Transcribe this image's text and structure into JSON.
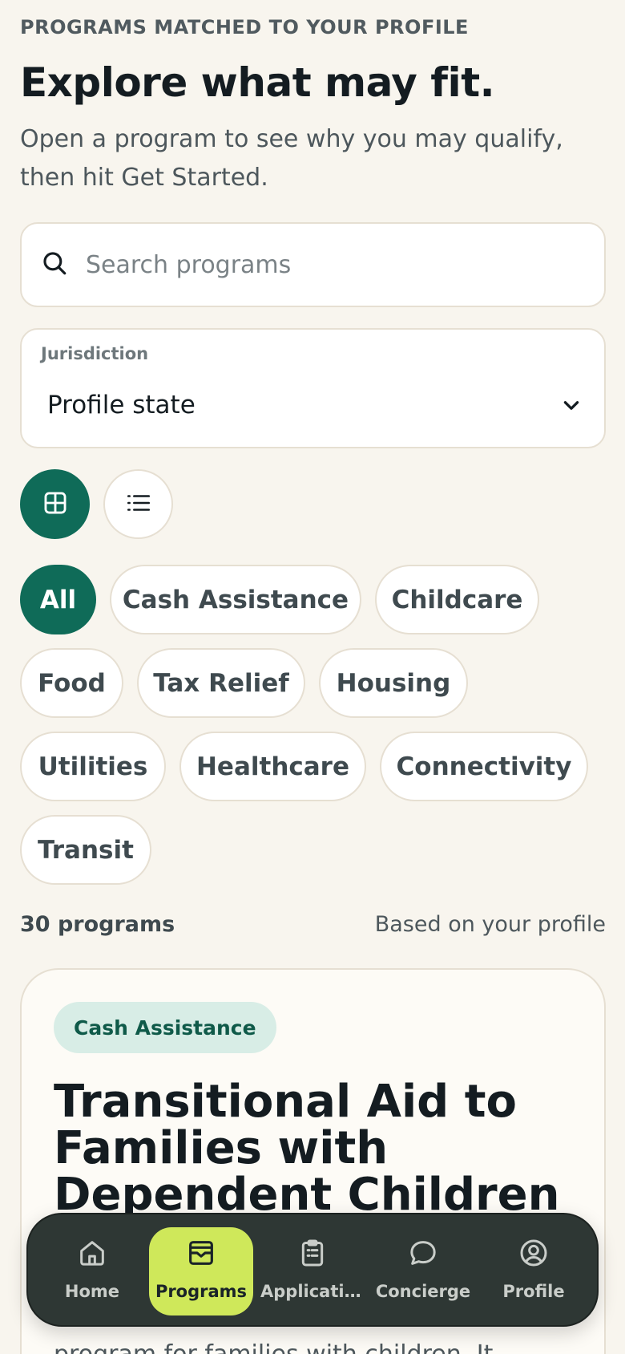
{
  "header": {
    "eyebrow": "PROGRAMS MATCHED TO YOUR PROFILE",
    "title": "Explore what may fit.",
    "subtitle": "Open a program to see why you may qualify, then hit Get Started."
  },
  "search": {
    "placeholder": "Search programs",
    "value": "",
    "icon": "search-icon"
  },
  "jurisdiction": {
    "label": "Jurisdiction",
    "value": "Profile state",
    "icon": "chevron-down-icon"
  },
  "view_toggle": {
    "selected": "grid",
    "options": [
      "grid",
      "list"
    ]
  },
  "filters": {
    "selected": "All",
    "chips": [
      "All",
      "Cash Assistance",
      "Childcare",
      "Food",
      "Tax Relief",
      "Housing",
      "Utilities",
      "Healthcare",
      "Connectivity",
      "Transit"
    ]
  },
  "results": {
    "count_label": "30 programs",
    "basis_label": "Based on your profile"
  },
  "cards": [
    {
      "category": "Cash Assistance",
      "title": "Transitional Aid to Families with Dependent Children",
      "description": "TAFDC is Massachusetts' cash assistance program for families with children. It"
    }
  ],
  "bottom_nav": {
    "active": "Programs",
    "items": [
      {
        "label": "Home",
        "icon": "home-icon"
      },
      {
        "label": "Programs",
        "icon": "programs-icon"
      },
      {
        "label": "Applicatio...",
        "icon": "clipboard-icon"
      },
      {
        "label": "Concierge",
        "icon": "chat-icon"
      },
      {
        "label": "Profile",
        "icon": "profile-icon"
      }
    ]
  },
  "colors": {
    "background": "#f8f5ee",
    "accent_green": "#0f6b58",
    "nav_background": "#2e3734",
    "nav_active": "#cfe85a",
    "badge_background": "#d8ede6"
  }
}
